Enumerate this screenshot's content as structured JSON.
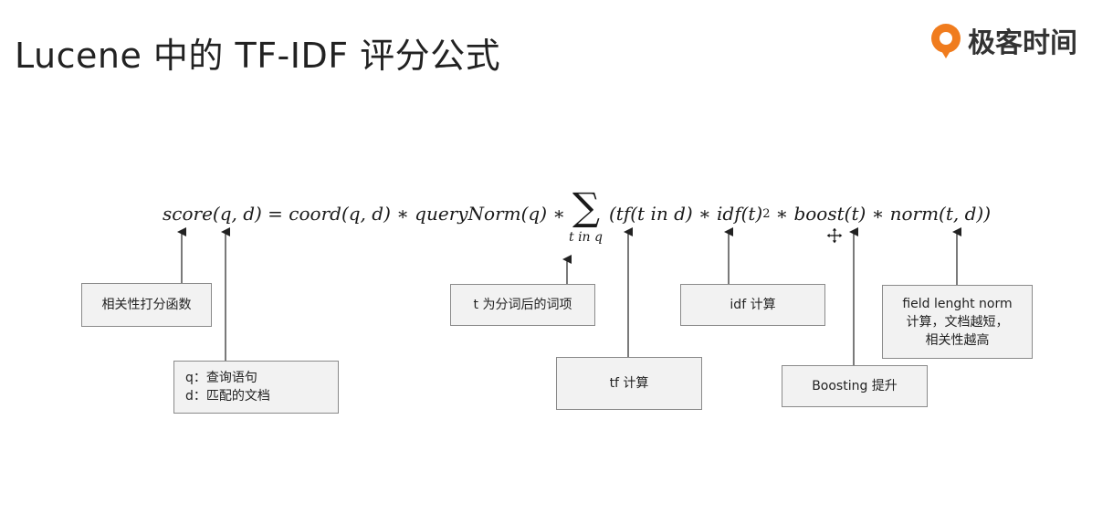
{
  "header": {
    "title": "Lucene 中的 TF-IDF 评分公式",
    "brand_text": "极客时间",
    "brand_color": "#f07c1e",
    "brand_logo_icon": "geektime-logo-icon"
  },
  "formula": {
    "part1": "score(q, d) = coord(q, d) ∗ queryNorm(q) ∗",
    "sum_symbol": "∑",
    "sum_subscript": "t in q",
    "part2": "(tf(t in d) ∗ idf(t)",
    "exponent": "2",
    "part3": "∗ boost(t) ∗ norm(t, d))"
  },
  "annotations": {
    "score_label": "相关性打分函数",
    "qd_line1": "q：查询语句",
    "qd_line2": "d：匹配的文档",
    "term_label": "t 为分词后的词项",
    "tf_label": "tf 计算",
    "idf_label": "idf 计算",
    "boost_label": "Boosting 提升",
    "norm_line1": "field lenght norm",
    "norm_line2": "计算，文档越短，",
    "norm_line3": "相关性越高"
  },
  "colors": {
    "box_fill": "#f2f2f2",
    "box_border": "#8a8a8a",
    "arrow": "#222222"
  }
}
